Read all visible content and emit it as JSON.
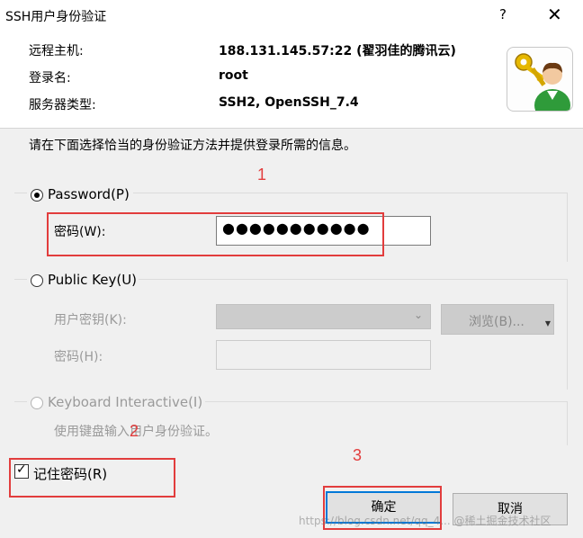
{
  "window": {
    "title": "SSH用户身份验证",
    "help_glyph": "?",
    "close_glyph": "✕"
  },
  "info": {
    "host_label": "远程主机:",
    "host_value": "188.131.145.57:22 (翟羽佳的腾讯云)",
    "user_label": "登录名:",
    "user_value": "root",
    "server_label": "服务器类型:",
    "server_value": "SSH2, OpenSSH_7.4"
  },
  "instruction": "请在下面选择恰当的身份验证方法并提供登录所需的信息。",
  "password_group": {
    "label": "Password(P)",
    "field_label": "密码(W):",
    "value": "●●●●●●●●●●●"
  },
  "publickey_group": {
    "label": "Public Key(U)",
    "userkey_label": "用户密钥(K):",
    "browse_label": "浏览(B)...",
    "passphrase_label": "密码(H):"
  },
  "keyboard_group": {
    "label": "Keyboard Interactive(I)",
    "description": "使用键盘输入用户身份验证。"
  },
  "remember": {
    "label": "记住密码(R)",
    "checked": true
  },
  "buttons": {
    "ok": "确定",
    "cancel": "取消"
  },
  "annotations": {
    "one": "1",
    "two": "2",
    "three": "3",
    "color": "#e23d3d"
  },
  "watermark": "https://blog.csdn.net/qq_4...  @稀土掘金技术社区",
  "icons": {
    "key_user": "key-user-icon",
    "dropdown": "chevron-down-icon"
  }
}
